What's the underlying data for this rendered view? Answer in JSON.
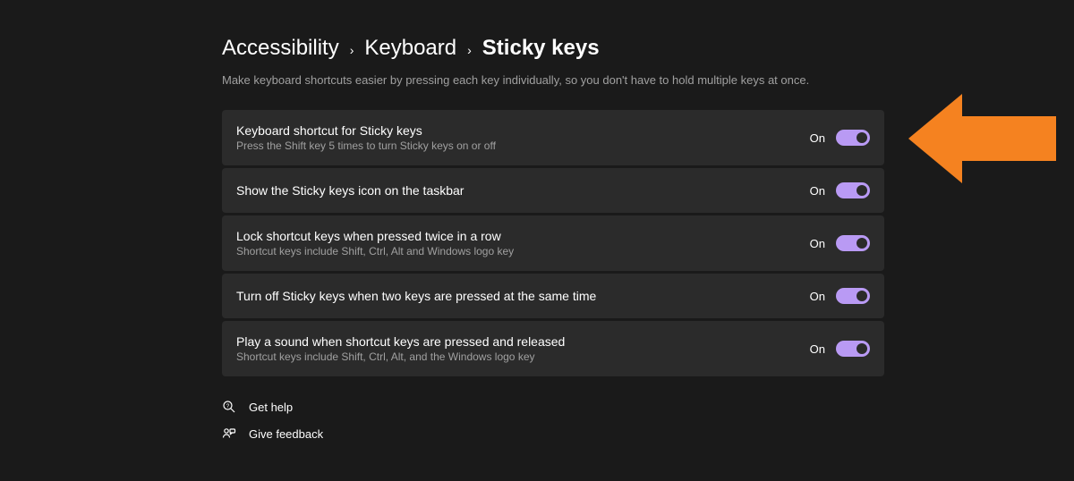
{
  "breadcrumb": {
    "level1": "Accessibility",
    "level2": "Keyboard",
    "current": "Sticky keys"
  },
  "description": "Make keyboard shortcuts easier by pressing each key individually, so you don't have to hold multiple keys at once.",
  "settings": [
    {
      "title": "Keyboard shortcut for Sticky keys",
      "subtitle": "Press the Shift key 5 times to turn Sticky keys on or off",
      "state_label": "On"
    },
    {
      "title": "Show the Sticky keys icon on the taskbar",
      "subtitle": "",
      "state_label": "On"
    },
    {
      "title": "Lock shortcut keys when pressed twice in a row",
      "subtitle": "Shortcut keys include Shift, Ctrl, Alt and Windows logo key",
      "state_label": "On"
    },
    {
      "title": "Turn off Sticky keys when two keys are pressed at the same time",
      "subtitle": "",
      "state_label": "On"
    },
    {
      "title": "Play a sound when shortcut keys are pressed and released",
      "subtitle": "Shortcut keys include Shift, Ctrl, Alt, and the Windows logo key",
      "state_label": "On"
    }
  ],
  "links": {
    "help": "Get help",
    "feedback": "Give feedback"
  }
}
